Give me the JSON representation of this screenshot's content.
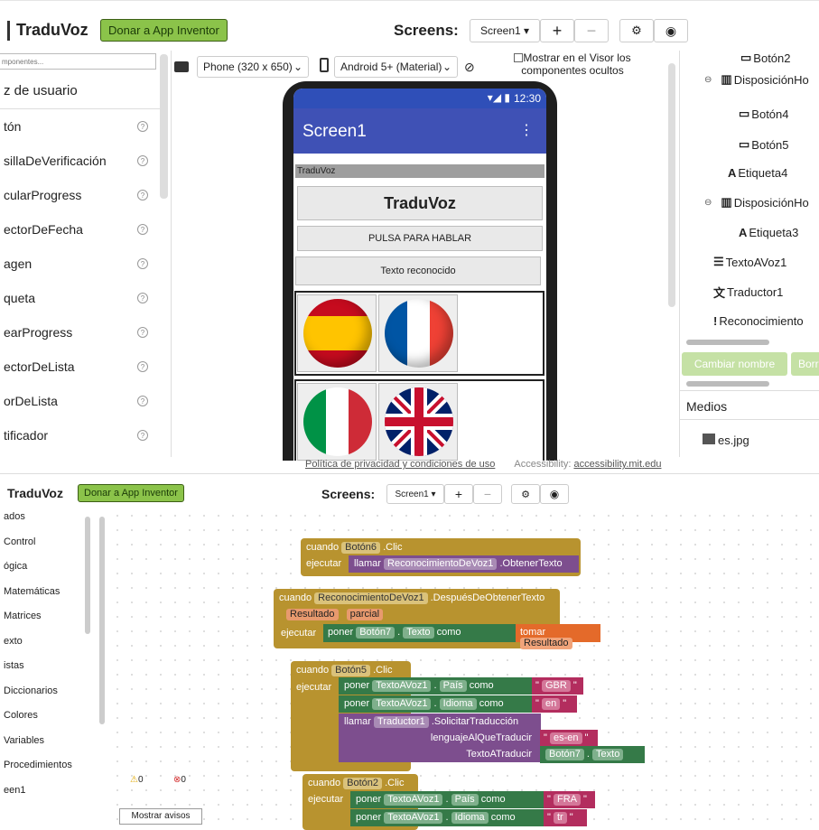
{
  "top": {
    "brand": "TraduVoz",
    "donate": "Donar a App Inventor",
    "screens_label": "Screens:",
    "screen_select": "Screen1 ▾"
  },
  "designer": {
    "search_placeholder": "mponentes...",
    "category": "z de usuario",
    "palette": [
      "tón",
      "sillaDeVerificación",
      "cularProgress",
      "ectorDeFecha",
      "agen",
      "queta",
      "earProgress",
      "ectorDeLista",
      "orDeLista",
      "tificador"
    ],
    "phone_select": "Phone (320 x 650)",
    "android_select": "Android 5+ (Material)",
    "show_hidden": "Mostrar en el Visor los componentes ocultos",
    "status_time": "12:30",
    "app_title": "Screen1",
    "app_label_bar": "TraduVoz",
    "app_heading": "TraduVoz",
    "speak_button": "PULSA PARA HABLAR",
    "recognized_text": "Texto reconocido",
    "components": [
      "Botón2",
      "DisposiciónHo",
      "Botón4",
      "Botón5",
      "Etiqueta4",
      "DisposiciónHo",
      "Etiqueta3",
      "TextoAVoz1",
      "Traductor1",
      "Reconocimiento"
    ],
    "rename_button": "Cambiar nombre",
    "delete_button": "Borr",
    "media_title": "Medios",
    "media_file": "es.jpg",
    "footer_privacy": "Política de privacidad y condiciones de uso",
    "footer_accessibility_prefix": "Accessibility:",
    "footer_accessibility_link": "accessibility.mit.edu"
  },
  "blocks": {
    "brand": "TraduVoz",
    "donate": "Donar a App Inventor",
    "screens_label": "Screens:",
    "screen_select": "Screen1 ▾",
    "categories": [
      "ados",
      "Control",
      "ógica",
      "Matemáticas",
      "Matrices",
      "exto",
      "istas",
      "Diccionarios",
      "Colores",
      "Variables",
      "Procedimientos",
      "een1"
    ],
    "warn_count": "0",
    "error_count": "0",
    "show_warnings": "Mostrar avisos",
    "b1": {
      "cuando": "cuando",
      "comp": "Botón6",
      "event": ".Clic",
      "ejecutar": "ejecutar",
      "llamar": "llamar",
      "target": "ReconocimientoDeVoz1",
      "method": ".ObtenerTexto"
    },
    "b2": {
      "cuando": "cuando",
      "comp": "ReconocimientoDeVoz1",
      "event": ".DespuésDeObtenerTexto",
      "p1": "Resultado",
      "p2": "parcial",
      "ejecutar": "ejecutar",
      "poner": "poner",
      "target": "Botón7",
      "prop": "Texto",
      "como": "como",
      "tomar": "tomar",
      "var": "Resultado"
    },
    "b3": {
      "cuando": "cuando",
      "comp": "Botón5",
      "event": ".Clic",
      "ejecutar": "ejecutar",
      "poner": "poner",
      "tts": "TextoAVoz1",
      "pais": "País",
      "como": "como",
      "gbr": "GBR",
      "idioma": "Idioma",
      "en": "en",
      "llamar": "llamar",
      "trad": "Traductor1",
      "method": ".SolicitarTraducción",
      "arg1": "lenguajeAlQueTraducir",
      "esen": "es-en",
      "arg2": "TextoATraducir",
      "btn7": "Botón7",
      "texto": "Texto"
    },
    "b4": {
      "cuando": "cuando",
      "comp": "Botón2",
      "event": ".Clic",
      "ejecutar": "ejecutar",
      "poner": "poner",
      "tts": "TextoAVoz1",
      "pais": "País",
      "como": "como",
      "fra": "FRA",
      "idioma": "Idioma",
      "tr": "tr"
    }
  }
}
